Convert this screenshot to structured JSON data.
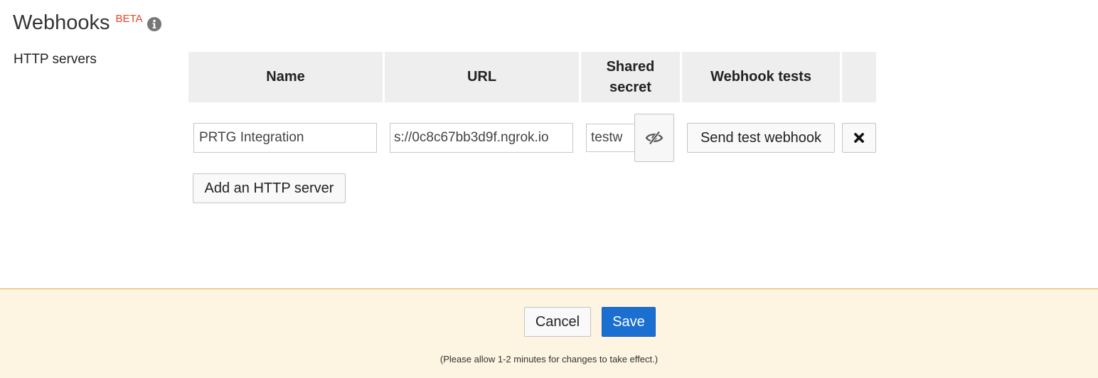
{
  "header": {
    "title": "Webhooks",
    "badge": "BETA"
  },
  "section": {
    "label": "HTTP servers"
  },
  "table": {
    "columns": [
      "Name",
      "URL",
      "Shared\nsecret",
      "Webhook tests",
      ""
    ],
    "rows": [
      {
        "name": "PRTG Integration",
        "url": "s://0c8c67bb3d9f.ngrok.io",
        "secret": "testw",
        "test_button": "Send test webhook"
      }
    ],
    "add_button": "Add an HTTP server"
  },
  "footer": {
    "cancel_label": "Cancel",
    "save_label": "Save",
    "note": "(Please allow 1-2 minutes for changes to take effect.)"
  },
  "colors": {
    "beta": "#e0452b",
    "primary": "#1a6fd0",
    "footer_bg": "#fdf4e1",
    "footer_border": "#e2b23a",
    "header_bg": "#eeeeee"
  },
  "icons": [
    "info-icon",
    "eye-slash-icon",
    "close-icon"
  ]
}
